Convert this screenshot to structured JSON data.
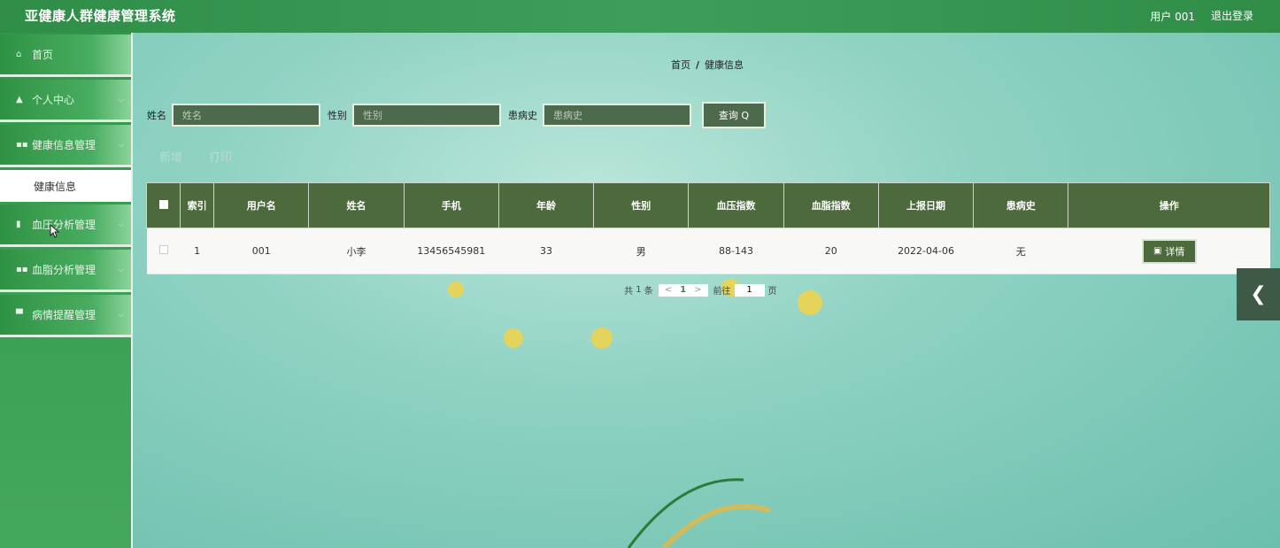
{
  "header": {
    "title": "亚健康人群健康管理系统",
    "user_text": "用户 001",
    "logout_label": "退出登录"
  },
  "sidebar": {
    "items": [
      {
        "label": "首页",
        "icon": "home-icon",
        "glyph": "⌂",
        "has_children": false
      },
      {
        "label": "个人中心",
        "icon": "user-icon",
        "glyph": "▲",
        "has_children": true
      },
      {
        "label": "健康信息管理",
        "icon": "grid-icon",
        "glyph": "▪▪",
        "has_children": true
      },
      {
        "label": "血压分析管理",
        "icon": "clipboard-icon",
        "glyph": "▮",
        "has_children": true
      },
      {
        "label": "血脂分析管理",
        "icon": "grid-icon",
        "glyph": "▪▪",
        "has_children": true
      },
      {
        "label": "病情提醒管理",
        "icon": "message-icon",
        "glyph": "▀",
        "has_children": true
      }
    ],
    "submenu_label": "健康信息",
    "chevron": "⌵"
  },
  "breadcrumb": {
    "home": "首页",
    "separator": "/",
    "current": "健康信息"
  },
  "search": {
    "name_label": "姓名",
    "name_placeholder": "姓名",
    "gender_label": "性别",
    "gender_placeholder": "性别",
    "history_label": "患病史",
    "history_placeholder": "患病史",
    "button_label": "查询 Q"
  },
  "actions": {
    "add_label": "新增",
    "print_label": "打印"
  },
  "table": {
    "columns": [
      "索引",
      "用户名",
      "姓名",
      "手机",
      "年龄",
      "性别",
      "血压指数",
      "血脂指数",
      "上报日期",
      "患病史",
      "操作"
    ],
    "rows": [
      {
        "index": "1",
        "username": "001",
        "name": "小李",
        "phone": "13456545981",
        "age": "33",
        "gender": "男",
        "bp": "88-143",
        "lipid": "20",
        "date": "2022-04-06",
        "history": "无"
      }
    ],
    "detail_label": "详情",
    "detail_glyph": "▣"
  },
  "pagination": {
    "total_prefix": "共",
    "total": "1",
    "total_suffix": "条",
    "prev": "<",
    "current_page": "1",
    "next": ">",
    "goto_prefix": "前往",
    "goto_value": "1",
    "goto_suffix": "页"
  },
  "collapse_tab": {
    "glyph": "❮"
  },
  "colors": {
    "header": "#2f8d47",
    "sidebar": "#3d9e55",
    "table_header": "#4d6a3c",
    "accent": "#f2d448"
  }
}
